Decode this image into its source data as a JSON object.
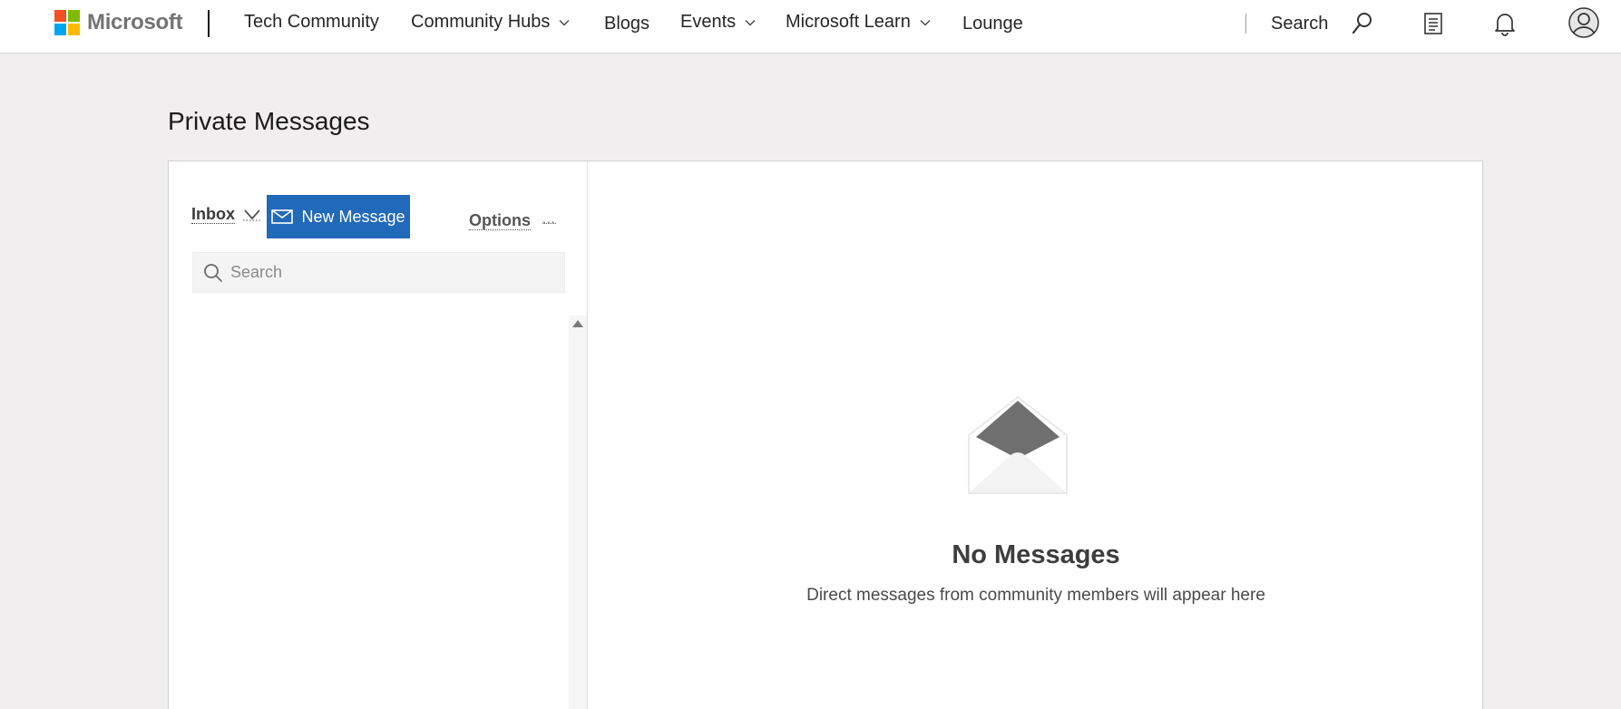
{
  "brand": {
    "logo_text": "Microsoft",
    "logo_colors": [
      "#f25022",
      "#7fba00",
      "#00a4ef",
      "#ffb900"
    ]
  },
  "nav": {
    "site_name": "Tech Community",
    "items": [
      {
        "label": "Community Hubs",
        "has_dropdown": true
      },
      {
        "label": "Blogs",
        "has_dropdown": false
      },
      {
        "label": "Events",
        "has_dropdown": true
      },
      {
        "label": "Microsoft Learn",
        "has_dropdown": true
      },
      {
        "label": "Lounge",
        "has_dropdown": false
      }
    ],
    "search_label": "Search",
    "icons": [
      "search-icon",
      "notes-icon",
      "bell-icon",
      "avatar-icon"
    ]
  },
  "page": {
    "title": "Private Messages"
  },
  "messages": {
    "folder_label": "Inbox",
    "new_message_label": "New Message",
    "options_label": "Options",
    "options_more": "...",
    "search_placeholder": "Search",
    "search_value": ""
  },
  "empty_state": {
    "title": "No Messages",
    "description": "Direct messages from community members will appear here"
  },
  "colors": {
    "accent": "#2169b9",
    "page_bg": "#f0eeef"
  }
}
